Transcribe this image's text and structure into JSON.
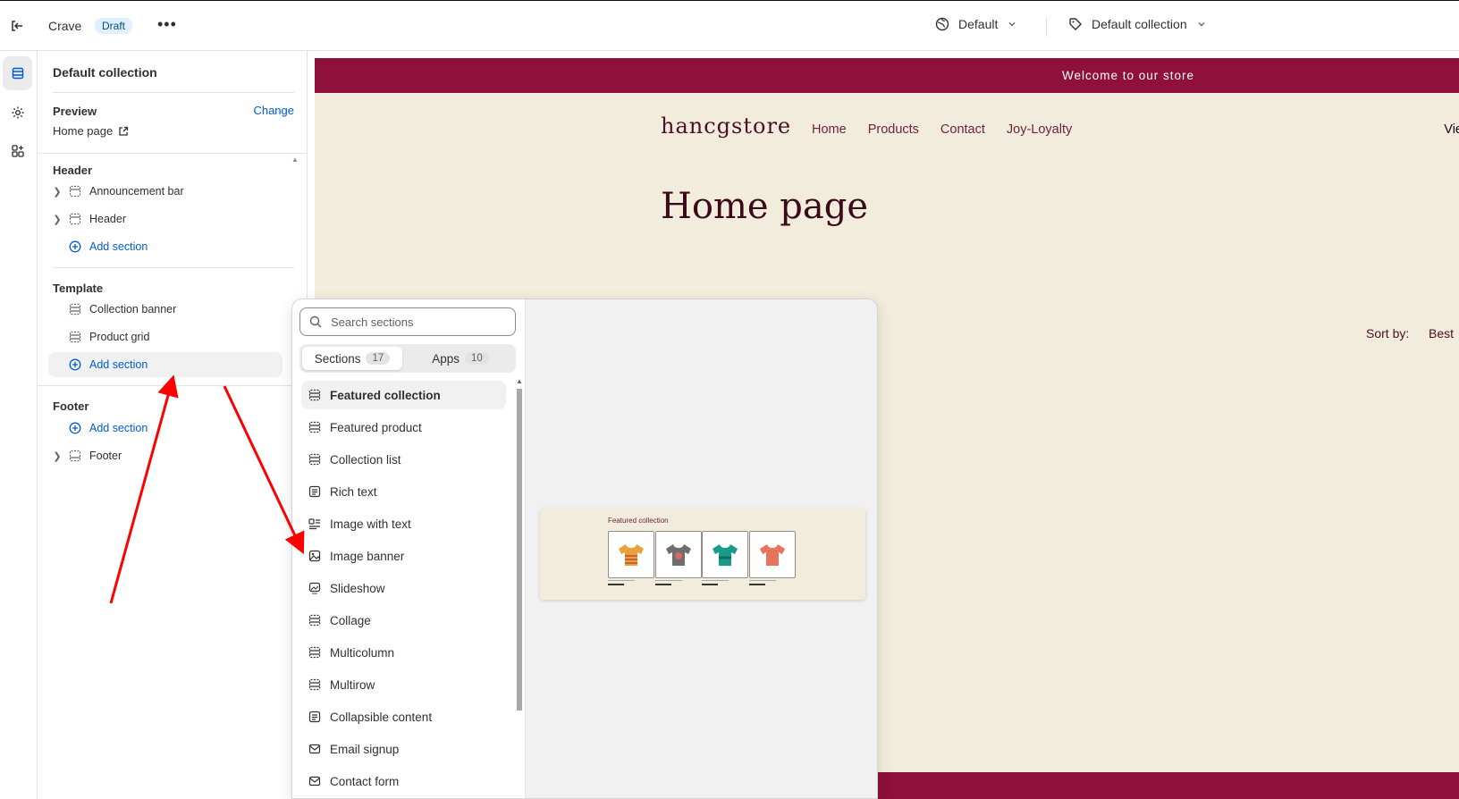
{
  "topbar": {
    "store_name": "Crave",
    "status_badge": "Draft",
    "more_label": "•••",
    "theme_selector": "Default",
    "template_selector": "Default collection"
  },
  "sidebar": {
    "title": "Default collection",
    "preview_label": "Preview",
    "change_link": "Change",
    "preview_page": "Home page",
    "groups": {
      "header": {
        "label": "Header",
        "items": [
          "Announcement bar",
          "Header"
        ],
        "add_label": "Add section"
      },
      "template": {
        "label": "Template",
        "items": [
          "Collection banner",
          "Product grid"
        ],
        "add_label": "Add section"
      },
      "footer": {
        "label": "Footer",
        "add_label": "Add section",
        "items": [
          "Footer"
        ]
      }
    }
  },
  "preview": {
    "announcement": "Welcome to our store",
    "logo": "hancgstore",
    "nav": [
      "Home",
      "Products",
      "Contact",
      "Joy-Loyalty"
    ],
    "nav_cut": "Vie",
    "page_heading": "Home page",
    "sort_label": "Sort by:",
    "sort_value": "Best"
  },
  "picker": {
    "search_placeholder": "Search sections",
    "tabs": [
      {
        "label": "Sections",
        "count": "17"
      },
      {
        "label": "Apps",
        "count": "10"
      }
    ],
    "sections": [
      {
        "label": "Featured collection",
        "icon": "layout-section-icon"
      },
      {
        "label": "Featured product",
        "icon": "layout-section-icon"
      },
      {
        "label": "Collection list",
        "icon": "layout-section-icon"
      },
      {
        "label": "Rich text",
        "icon": "text-block-icon"
      },
      {
        "label": "Image with text",
        "icon": "image-with-text-icon"
      },
      {
        "label": "Image banner",
        "icon": "image-icon"
      },
      {
        "label": "Slideshow",
        "icon": "slideshow-icon"
      },
      {
        "label": "Collage",
        "icon": "layout-section-icon"
      },
      {
        "label": "Multicolumn",
        "icon": "layout-section-icon"
      },
      {
        "label": "Multirow",
        "icon": "layout-section-icon"
      },
      {
        "label": "Collapsible content",
        "icon": "text-block-icon"
      },
      {
        "label": "Email signup",
        "icon": "email-icon"
      },
      {
        "label": "Contact form",
        "icon": "email-icon"
      }
    ],
    "thumbnail_title": "Featured collection"
  },
  "colors": {
    "brand": "#8e103b",
    "accent_link": "#005bd3",
    "preview_bg": "#f2ecdc",
    "annotation_arrow": "#ff0000"
  }
}
